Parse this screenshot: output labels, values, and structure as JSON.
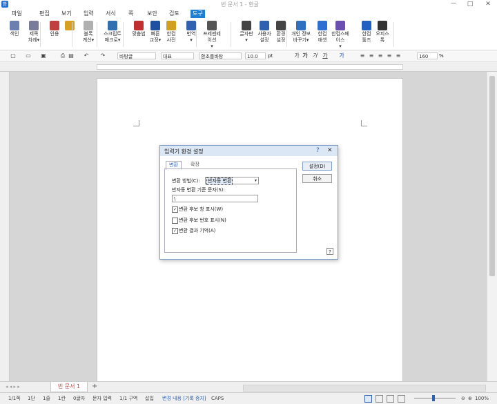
{
  "window": {
    "title": "빈 문서 1 - 한글",
    "logo": "한",
    "controls": [
      "ㅡ",
      "□",
      "✕"
    ]
  },
  "menu": [
    {
      "label": "파일",
      "active": false
    },
    {
      "label": "편집",
      "active": false
    },
    {
      "label": "보기",
      "active": false
    },
    {
      "label": "입력",
      "active": false
    },
    {
      "label": "서식",
      "active": false
    },
    {
      "label": "쪽",
      "active": false
    },
    {
      "label": "보안",
      "active": false
    },
    {
      "label": "검토",
      "active": false
    },
    {
      "label": "도구",
      "active": true
    }
  ],
  "ribbon": [
    {
      "l1": "색인",
      "l2": "",
      "icon": "index-icon",
      "color": "#6b7fb0"
    },
    {
      "l1": "제목",
      "l2": "차례▾",
      "icon": "toc-icon",
      "color": "#7a7a9a"
    },
    {
      "l1": "인용",
      "l2": "",
      "icon": "citation-icon",
      "color": "#c04040"
    },
    {
      "l1": "",
      "l2": "",
      "icon": "merge-icon",
      "color": "#d8a020"
    },
    {
      "l1": "블록",
      "l2": "계산▾",
      "icon": "block-calc-icon",
      "color": "#b0b0b0"
    },
    {
      "l1": "스크립트",
      "l2": "매크로▾",
      "icon": "macro-icon",
      "color": "#3070b0"
    },
    {
      "l1": "맞춤법",
      "l2": "",
      "icon": "spellcheck-icon",
      "color": "#c03030"
    },
    {
      "l1": "빠른",
      "l2": "교정▾",
      "icon": "autocorrect-icon",
      "color": "#2050a0"
    },
    {
      "l1": "한컴",
      "l2": "사전",
      "icon": "dictionary-icon",
      "color": "#d0a020"
    },
    {
      "l1": "번역",
      "l2": "▾",
      "icon": "translate-icon",
      "color": "#3060b0"
    },
    {
      "l1": "프레젠테이션",
      "l2": "▾",
      "icon": "presentation-icon",
      "color": "#555"
    },
    {
      "l1": "글자판",
      "l2": "▾",
      "icon": "keyboard-icon",
      "color": "#444"
    },
    {
      "l1": "사용자",
      "l2": "설정",
      "icon": "user-settings-icon",
      "color": "#3060b0"
    },
    {
      "l1": "환경",
      "l2": "설정",
      "icon": "gear-icon",
      "color": "#444"
    },
    {
      "l1": "개인 정보",
      "l2": "바꾸기▾",
      "icon": "privacy-icon",
      "color": "#3070c0"
    },
    {
      "l1": "한컴",
      "l2": "애셋",
      "icon": "asset-icon",
      "color": "#2c6fd0"
    },
    {
      "l1": "한컴스페이스",
      "l2": "▾",
      "icon": "hancom-space-icon",
      "color": "#6a4fb0"
    },
    {
      "l1": "한컴",
      "l2": "툴즈",
      "icon": "tools-icon",
      "color": "#2060c0"
    },
    {
      "l1": "오피스",
      "l2": "톡",
      "icon": "office-talk-icon",
      "color": "#333"
    }
  ],
  "format": {
    "style": "바탕글",
    "lang": "대표",
    "font": "함초롬바탕",
    "size": "10.0",
    "size_unit": "pt",
    "zoom": "160",
    "zoom_unit": "%"
  },
  "doc_tab": "빈 문서 1",
  "status": {
    "items": [
      "1/1쪽",
      "1단",
      "1줄",
      "1칸",
      "0글자",
      "문자 입력",
      "1/1 구역",
      "삽입",
      "변경 내용 [기록 중지]",
      "CAPS"
    ],
    "zoom": "100%"
  },
  "dialog": {
    "title": "입력기 환경 설정",
    "help": "?",
    "close": "✕",
    "tabs": [
      "변환",
      "확장"
    ],
    "method_label": "변환 방법(C):",
    "method_value": "반자동 변환",
    "char_label": "반자동 변환 기준 문자(S):",
    "char_value": "\\",
    "checks": [
      {
        "label": "변환 후보 창 표시(W)",
        "checked": true
      },
      {
        "label": "변환 후보 번호 표시(N)",
        "checked": false
      },
      {
        "label": "변환 결과 기억(A)",
        "checked": true
      }
    ],
    "ok": "설정(D)",
    "cancel": "취소",
    "panel_help": "?"
  }
}
